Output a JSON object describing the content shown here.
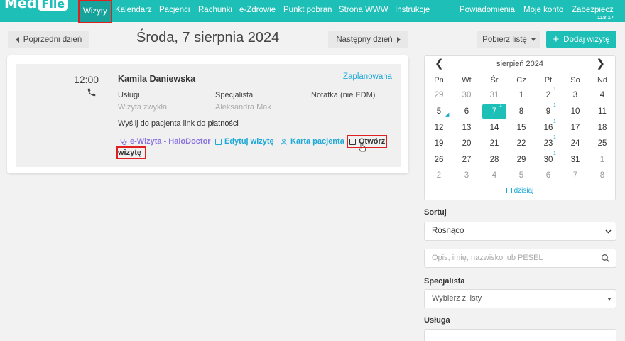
{
  "app": {
    "logo_med": "Med",
    "logo_file": "File"
  },
  "nav": {
    "items": [
      "Wizyty",
      "Kalendarz",
      "Pacjenci",
      "Rachunki",
      "e-Zdrowie",
      "Punkt pobrań",
      "Strona WWW",
      "Instrukcje"
    ],
    "right_items": [
      "Powiadomienia",
      "Moje konto",
      "Zabezpiecz"
    ],
    "clock": "118:17"
  },
  "daynav": {
    "prev_label": "Poprzedni dzień",
    "title": "Środa, 7 sierpnia 2024",
    "next_label": "Następny dzień",
    "download_label": "Pobierz listę",
    "add_label": "Dodaj wizytę"
  },
  "visit": {
    "time": "12:00",
    "patient": "Kamila Daniewska",
    "status": "Zaplanowana",
    "services_label": "Usługi",
    "services_value": "Wizyta zwykła",
    "specialist_label": "Specjalista",
    "specialist_value": "Aleksandra Mak",
    "note_label": "Notatka (nie EDM)",
    "payment_notice": "Wyślij do pacjenta link do płatności",
    "action_ewizyta_l1": "e-Wizyta - HaloDoctor",
    "action_ewizyta_l2": "wizytę",
    "action_edit": "Edytuj wizytę",
    "action_card": "Karta pacjenta",
    "action_open": "Otwórz"
  },
  "calendar": {
    "month": "sierpień 2024",
    "prev": "❮",
    "next": "❯",
    "dow": [
      "Pn",
      "Wt",
      "Śr",
      "Cz",
      "Pt",
      "So",
      "Nd"
    ],
    "weeks": [
      [
        "29",
        "30",
        "31",
        "1",
        "2",
        "3",
        "4"
      ],
      [
        "5",
        "6",
        "7",
        "8",
        "9",
        "10",
        "11"
      ],
      [
        "12",
        "13",
        "14",
        "15",
        "16",
        "17",
        "18"
      ],
      [
        "19",
        "20",
        "21",
        "22",
        "23",
        "24",
        "25"
      ],
      [
        "26",
        "27",
        "28",
        "29",
        "30",
        "31",
        "1"
      ],
      [
        "2",
        "3",
        "4",
        "5",
        "6",
        "7",
        "8"
      ]
    ],
    "today_label": "dzisiaj",
    "today_color": "#1dbfb6"
  },
  "filters": {
    "sort_label": "Sortuj",
    "sort_value": "Rosnąco",
    "search_placeholder": "Opis, imię, nazwisko lub PESEL",
    "specialist_label": "Specjalista",
    "specialist_value": "Wybierz z listy",
    "service_label": "Usługa"
  },
  "colors": {
    "accent": "#1dbfb6",
    "link": "#1da8d6",
    "highlight": "#e02020"
  }
}
